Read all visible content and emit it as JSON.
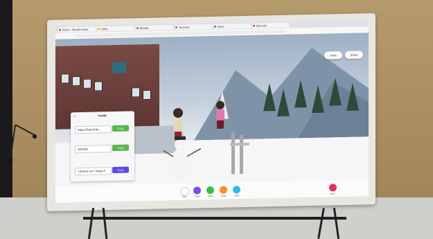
{
  "browser": {
    "tabs": [
      {
        "label": "Room - Mozilla Hubs",
        "color": "#e8453c"
      },
      {
        "label": "Hubs",
        "color": "#f4b400"
      },
      {
        "label": "Mozilla",
        "color": "#e8453c"
      },
      {
        "label": "YouTube",
        "color": "#e8453c"
      },
      {
        "label": "Docs",
        "color": "#1a73e8"
      },
      {
        "label": "New tab",
        "color": "#e8453c"
      }
    ]
  },
  "invite_panel": {
    "title": "Invite",
    "room_link_value": "https://hub.link/...",
    "room_link_button": "Copy",
    "room_code_value": "308460",
    "room_code_button": "Copy",
    "embed_value": "<iframe src=\"https://",
    "embed_button": "Copy",
    "accent_copy": "#5ab64a",
    "accent_embed": "#5b4be3"
  },
  "top_buttons": [
    "Invite",
    "Share"
  ],
  "bottom_bar": {
    "actions": [
      {
        "label": "Voice",
        "color": "#ffffff",
        "icon": "mic-icon"
      },
      {
        "label": "Share",
        "color": "#7b4ee8",
        "icon": "share-icon"
      },
      {
        "label": "Place",
        "color": "#3bbf4a",
        "icon": "place-icon"
      },
      {
        "label": "React",
        "color": "#ff8a2a",
        "icon": "react-icon"
      },
      {
        "label": "Chat",
        "color": "#35b7e8",
        "icon": "chat-icon"
      }
    ],
    "leave": {
      "label": "Leave",
      "color": "#e6315f"
    }
  }
}
